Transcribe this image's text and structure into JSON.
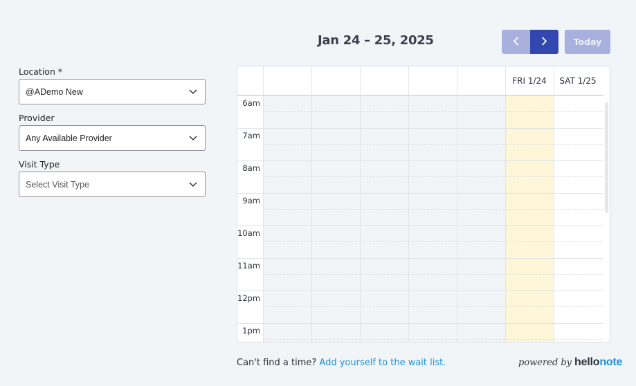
{
  "header": {
    "date_range": "Jan 24 – 25, 2025",
    "today_label": "Today"
  },
  "form": {
    "location": {
      "label": "Location *",
      "value": "@ADemo New"
    },
    "provider": {
      "label": "Provider",
      "value": "Any Available Provider"
    },
    "visit_type": {
      "label": "Visit Type",
      "placeholder": "Select Visit Type"
    }
  },
  "calendar": {
    "days": [
      {
        "label": "",
        "state": "past"
      },
      {
        "label": "",
        "state": "past"
      },
      {
        "label": "",
        "state": "past"
      },
      {
        "label": "",
        "state": "past"
      },
      {
        "label": "",
        "state": "past"
      },
      {
        "label": "FRI 1/24",
        "state": "today"
      },
      {
        "label": "SAT 1/25",
        "state": "future"
      }
    ],
    "times": [
      "6am",
      "7am",
      "8am",
      "9am",
      "10am",
      "11am",
      "12pm",
      "1pm"
    ]
  },
  "footer": {
    "prompt": "Can't find a time?",
    "link": "Add yourself to the wait list.",
    "powered_by": "powered by",
    "brand_a": "hello",
    "brand_b": "note"
  },
  "colors": {
    "past_day": "#f2f5f8",
    "today": "#fdf6d8",
    "primary": "#3347b1",
    "primary_light": "#a8b1de",
    "link": "#1c8fd6"
  },
  "icons": {
    "prev": "chevron-left-icon",
    "next": "chevron-right-icon",
    "dropdown": "chevron-down-icon"
  }
}
